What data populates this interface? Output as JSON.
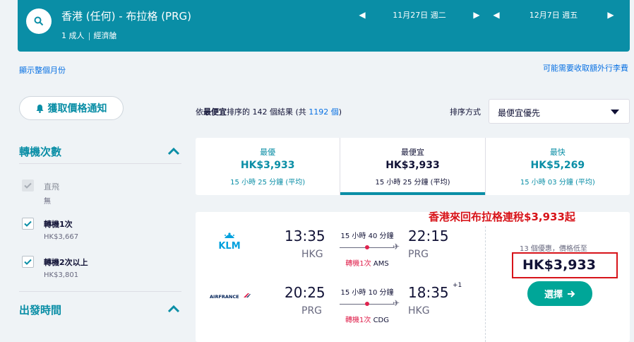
{
  "header": {
    "route": "香港 (任何) - 布拉格 (PRG)",
    "passengers": "1 成人",
    "cabin": "經濟艙",
    "depart_date": "11月27日 週二",
    "return_date": "12月7日 週五"
  },
  "links": {
    "show_month": "顯示整個月份",
    "extra_fees": "可能需要收取額外行李費"
  },
  "sidebar": {
    "price_alert_label": "獲取價格通知",
    "stops_title": "轉機次數",
    "stops_options": [
      {
        "label": "直飛",
        "price": "無",
        "checked": true,
        "disabled": true
      },
      {
        "label": "轉機1次",
        "price": "HK$3,667",
        "checked": true,
        "disabled": false
      },
      {
        "label": "轉機2次以上",
        "price": "HK$3,801",
        "checked": true,
        "disabled": false
      }
    ],
    "departure_title": "出發時間"
  },
  "results": {
    "prefix": "依",
    "sort_name": "最便宜",
    "middle": "排序的 142 個結果 (共 ",
    "total": "1192 個",
    "suffix": ")",
    "sort_label": "排序方式",
    "sort_value": "最便宜優先"
  },
  "tabs": [
    {
      "label": "最優",
      "price": "HK$3,933",
      "duration": "15 小時 25 分鐘 (平均)",
      "active": false
    },
    {
      "label": "最便宜",
      "price": "HK$3,933",
      "duration": "15 小時 25 分鐘 (平均)",
      "active": true
    },
    {
      "label": "最快",
      "price": "HK$5,269",
      "duration": "15 小時 03 分鐘 (平均)",
      "active": false
    }
  ],
  "result": {
    "outbound": {
      "airline": "KLM",
      "depart_time": "13:35",
      "depart_code": "HKG",
      "duration": "15 小時 40 分鐘",
      "stops": "轉機1次",
      "via": "AMS",
      "arrive_time": "22:15",
      "arrive_code": "PRG"
    },
    "inbound": {
      "airline": "AIRFRANCE",
      "depart_time": "20:25",
      "depart_code": "PRG",
      "duration": "15 小時 10 分鐘",
      "stops": "轉機1次",
      "via": "CDG",
      "arrive_time": "18:35",
      "arrive_code": "HKG",
      "day_offset": "+1"
    },
    "deals": "13 個優惠，價格低至",
    "price": "HK$3,933",
    "select_label": "選擇"
  },
  "annotation": "香港來回布拉格連稅$3,933起",
  "colors": {
    "header_bg": "#0a8ea6",
    "link": "#0770e3",
    "stop_red": "#e0234e",
    "select_btn": "#00a698",
    "highlight_red": "#d7141a"
  },
  "icons": [
    "search-icon",
    "bell-icon",
    "chevron-up-icon",
    "check-icon",
    "plane-icon",
    "arrow-right-icon",
    "klm-logo",
    "airfrance-logo"
  ]
}
